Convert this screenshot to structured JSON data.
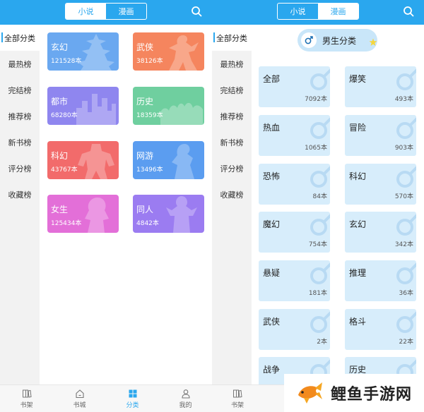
{
  "left": {
    "tabs": [
      {
        "label": "小说",
        "active": true
      },
      {
        "label": "漫画",
        "active": false
      }
    ],
    "sidebar": [
      {
        "label": "全部分类",
        "active": true
      },
      {
        "label": "最热榜"
      },
      {
        "label": "完结榜"
      },
      {
        "label": "推荐榜"
      },
      {
        "label": "新书榜"
      },
      {
        "label": "评分榜"
      },
      {
        "label": "收藏榜"
      }
    ],
    "categories": [
      {
        "name": "玄幻",
        "count": "121528本",
        "color": "#6aa8f0"
      },
      {
        "name": "武侠",
        "count": "38126本",
        "color": "#f5855e"
      },
      {
        "name": "都市",
        "count": "68280本",
        "color": "#8f86ef"
      },
      {
        "name": "历史",
        "count": "18359本",
        "color": "#6fcf9f"
      },
      {
        "name": "科幻",
        "count": "43767本",
        "color": "#f26b6b"
      },
      {
        "name": "网游",
        "count": "13496本",
        "color": "#5b9df0"
      },
      {
        "name": "女生",
        "count": "125434本",
        "color": "#e36fd8"
      },
      {
        "name": "同人",
        "count": "4842本",
        "color": "#9b7cf1"
      }
    ],
    "nav": [
      {
        "label": "书架",
        "icon": "bookshelf-icon"
      },
      {
        "label": "书城",
        "icon": "home-icon"
      },
      {
        "label": "分类",
        "icon": "category-icon",
        "active": true
      },
      {
        "label": "我的",
        "icon": "user-icon"
      }
    ]
  },
  "right": {
    "tabs": [
      {
        "label": "小说",
        "active": false
      },
      {
        "label": "漫画",
        "active": true
      }
    ],
    "sidebar": [
      {
        "label": "全部分类",
        "active": true
      },
      {
        "label": "最热榜"
      },
      {
        "label": "完结榜"
      },
      {
        "label": "推荐榜"
      },
      {
        "label": "新书榜"
      },
      {
        "label": "评分榜"
      },
      {
        "label": "收藏榜"
      }
    ],
    "gender_button": "男生分类",
    "genres": [
      {
        "name": "全部",
        "count": "7092本"
      },
      {
        "name": "爆笑",
        "count": "493本"
      },
      {
        "name": "热血",
        "count": "1065本"
      },
      {
        "name": "冒险",
        "count": "903本"
      },
      {
        "name": "恐怖",
        "count": "84本"
      },
      {
        "name": "科幻",
        "count": "570本"
      },
      {
        "name": "魔幻",
        "count": "754本"
      },
      {
        "name": "玄幻",
        "count": "342本"
      },
      {
        "name": "悬疑",
        "count": "181本"
      },
      {
        "name": "推理",
        "count": "36本"
      },
      {
        "name": "武侠",
        "count": "2本"
      },
      {
        "name": "格斗",
        "count": "22本"
      },
      {
        "name": "战争",
        "count": ""
      },
      {
        "name": "历史",
        "count": ""
      }
    ],
    "nav": [
      {
        "label": "书架",
        "icon": "bookshelf-icon"
      }
    ]
  },
  "watermark": {
    "text": "鲤鱼手游网"
  },
  "colors": {
    "accent": "#2aa7ee",
    "genre_card": "#d7edfb"
  }
}
